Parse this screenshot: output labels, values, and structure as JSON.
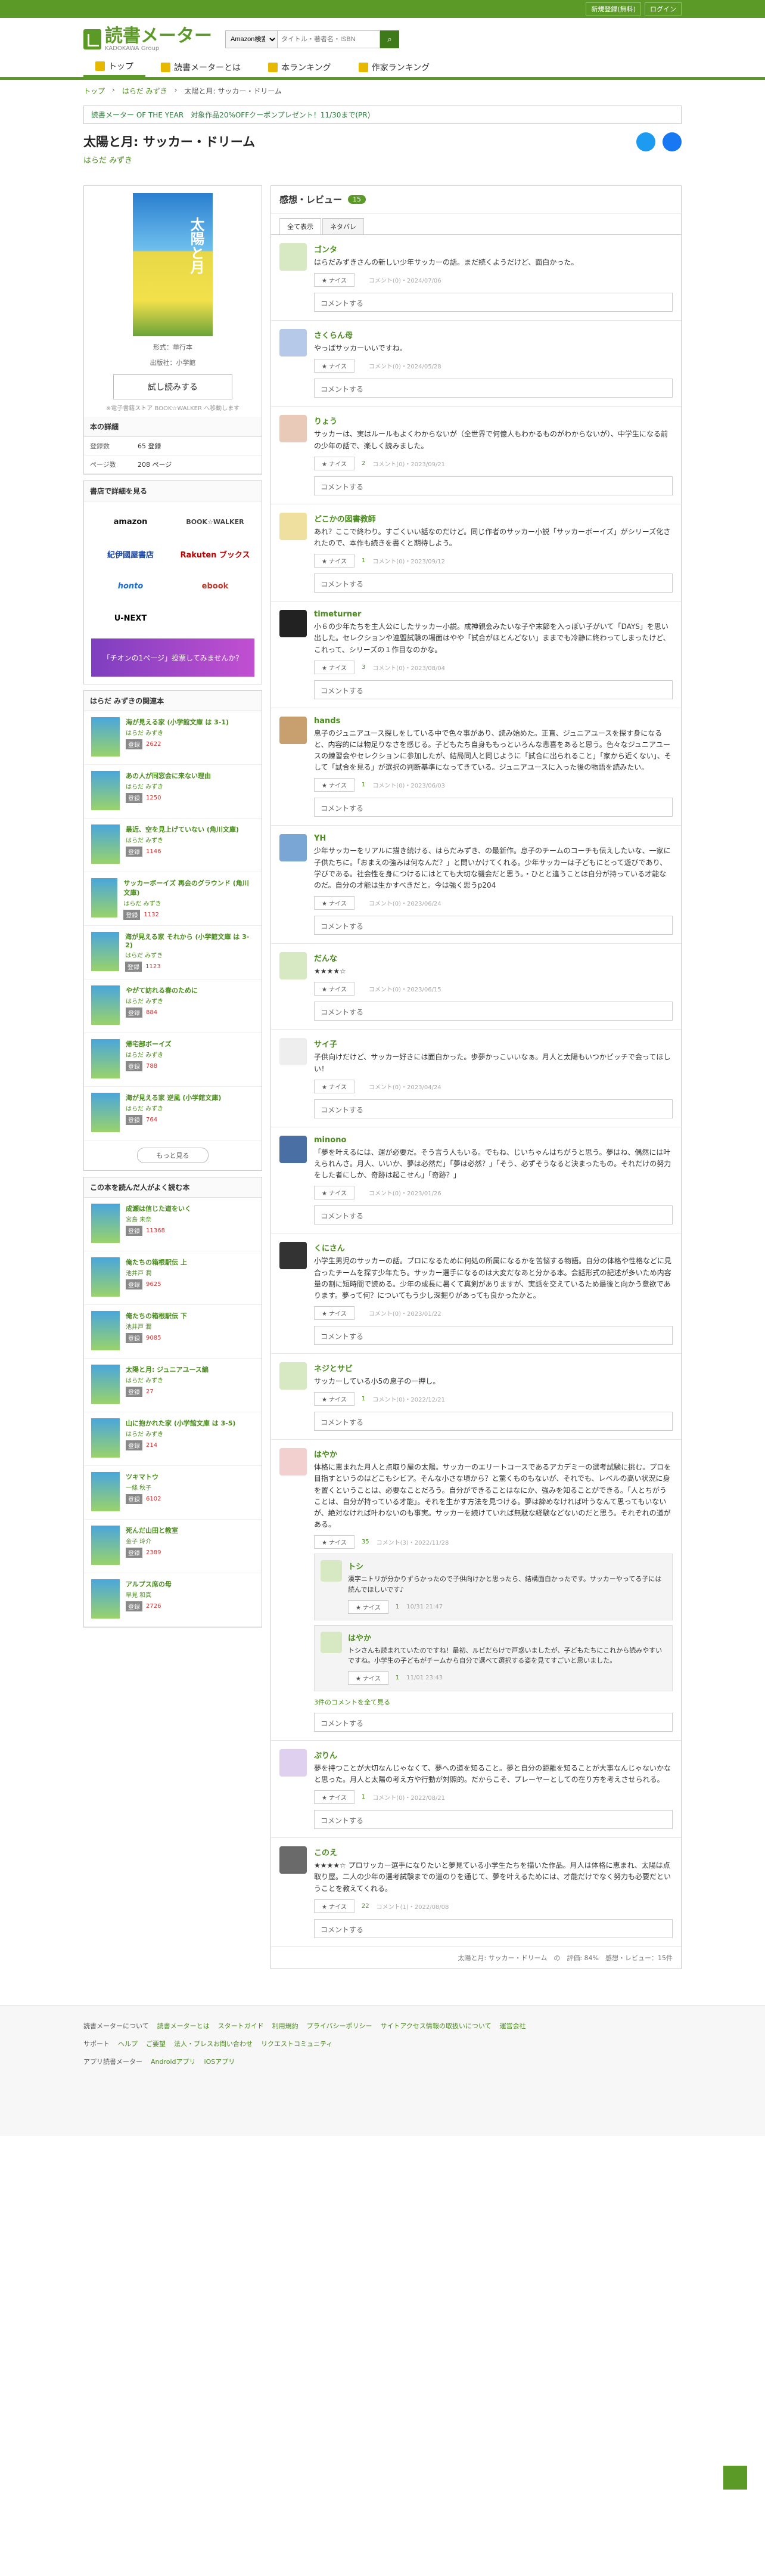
{
  "topbar": {
    "signup": "新規登録(無料)",
    "login": "ログイン"
  },
  "header": {
    "logo_title": "読書メーター",
    "logo_sub": "KADOKAWA Group",
    "search_select": "Amazon検索",
    "search_placeholder": "タイトル・著者名・ISBN"
  },
  "nav": [
    "トップ",
    "読書メーターとは",
    "本ランキング",
    "作家ランキング"
  ],
  "breadcrumb": [
    "トップ",
    "はらだ みずき",
    "太陽と月: サッカー・ドリーム"
  ],
  "banner": "読書メーター OF THE YEAR　対象作品20%OFFクーポンプレゼント！11/30まで(PR)",
  "book": {
    "title": "太陽と月: サッカー・ドリーム",
    "author": "はらだ みずき",
    "format": "形式：単行本",
    "publisher": "出版社：小学館",
    "try": "試し読みする",
    "note": "※電子書籍ストア BOOK☆WALKER へ移動します",
    "cover_text": "太陽と月"
  },
  "details": {
    "heading": "本の詳細",
    "pages_label": "登録数",
    "pages_value": "65 登録",
    "p2_label": "ページ数",
    "p2_value": "208 ページ"
  },
  "stores": {
    "heading": "書店で詳細を見る",
    "items": [
      "amazon",
      "BOOK☆WALKER",
      "紀伊國屋書店",
      "Rakuten ブックス",
      "honto",
      "ebook",
      "U-NEXT"
    ],
    "promo": "「チオンの1ページ」投票してみませんか？"
  },
  "related": {
    "heading": "はらだ みずきの関連本",
    "more": "もっと見る",
    "items": [
      {
        "title": "海が見える家 (小学館文庫 は 3-1)",
        "author": "はらだ みずき",
        "count": "2622"
      },
      {
        "title": "あの人が同窓会に来ない理由",
        "author": "はらだ みずき",
        "count": "1250"
      },
      {
        "title": "最近、空を見上げていない (角川文庫)",
        "author": "はらだ みずき",
        "count": "1146"
      },
      {
        "title": "サッカーボーイズ 再会のグラウンド (角川文庫)",
        "author": "はらだ みずき",
        "count": "1132"
      },
      {
        "title": "海が見える家 それから (小学館文庫 は 3-2)",
        "author": "はらだ みずき",
        "count": "1123"
      },
      {
        "title": "やがて訪れる春のために",
        "author": "はらだ みずき",
        "count": "884"
      },
      {
        "title": "帰宅部ボーイズ",
        "author": "はらだ みずき",
        "count": "788"
      },
      {
        "title": "海が見える家 逆風 (小学館文庫)",
        "author": "はらだ みずき",
        "count": "764"
      }
    ]
  },
  "alsoread": {
    "heading": "この本を読んだ人がよく読む本",
    "items": [
      {
        "title": "成瀬は信じた道をいく",
        "author": "宮島 未奈",
        "count": "11368"
      },
      {
        "title": "俺たちの箱根駅伝 上",
        "author": "池井戸 潤",
        "count": "9625"
      },
      {
        "title": "俺たちの箱根駅伝 下",
        "author": "池井戸 潤",
        "count": "9085"
      },
      {
        "title": "太陽と月: ジュニアユース編",
        "author": "はらだ みずき",
        "count": "27"
      },
      {
        "title": "山に抱かれた家 (小学館文庫 は 3-5)",
        "author": "はらだ みずき",
        "count": "214"
      },
      {
        "title": "ツキマトウ",
        "author": "一條 秋子",
        "count": "6102"
      },
      {
        "title": "死んだ山田と教室",
        "author": "金子 玲介",
        "count": "2389"
      },
      {
        "title": "アルプス席の母",
        "author": "早見 和真",
        "count": "2726"
      }
    ]
  },
  "reviews": {
    "heading": "感想・レビュー",
    "count": "15",
    "tabs": [
      "全て表示",
      "ネタバレ"
    ],
    "nice": "ナイス",
    "comment_box": "コメントする",
    "items": [
      {
        "name": "ゴンタ",
        "text": "はらだみずきさんの新しい少年サッカーの話。まだ続くようだけど、面白かった。",
        "likes": "",
        "date": "コメント(0)・2024/07/06"
      },
      {
        "name": "さくらん母",
        "text": "やっぱサッカーいいですね。",
        "likes": "",
        "date": "コメント(0)・2024/05/28"
      },
      {
        "name": "りょう",
        "text": "サッカーは、実はルールもよくわからないが（全世界で何億人もわかるものがわからないが）、中学生になる前の少年の話で、楽しく読みました。",
        "likes": "2",
        "date": "コメント(0)・2023/09/21"
      },
      {
        "name": "どこかの図書教師",
        "text": "あれ？ここで終わり。すごくいい話なのだけど。同じ作者のサッカー小説「サッカーボーイズ」がシリーズ化されたので、本作も続きを書くと期待しよう。",
        "likes": "1",
        "date": "コメント(0)・2023/09/12"
      },
      {
        "name": "timeturner",
        "text": "小６の少年たちを主人公にしたサッカー小説。成神親会みたいな子や末節を入っぽい子がいて「DAYS」を思い出した。セレクションや連盟試験の場面はやや「試合がほとんどない」ままでも冷静に終わってしまったけど、これって、シリーズの１作目なのかな。",
        "likes": "3",
        "date": "コメント(0)・2023/08/04"
      },
      {
        "name": "hands",
        "text": "息子のジュニアユース探しをしている中で色々事があり、読み始めた。正直、ジュニアユースを探す身になると、内容的には物足りなさを感じる。子どもたち自身ももっといろんな悲喜をあると思う。色々なジュニアユースの練習会やセレクションに参加したが、結局同人と同じように「試合に出られること」「家から近くない」、そして「試合を見る」が選択の判断基準になってきている。ジュニアユースに入った後の物語を読みたい。",
        "likes": "1",
        "date": "コメント(0)・2023/06/03"
      },
      {
        "name": "YH",
        "text": "少年サッカーをリアルに描き続ける、はらだみずき、の最新作。息子のチームのコーチも伝えしたいな、一家に子供たちに。「おまえの強みは何なんだ？」と問いかけてくれる。少年サッカーは子どもにとって遊びであり、学びである。社会性を身につけるにはとても大切な機会だと思う。・ひとと違うことは自分が持っている才能なのだ。自分の才能は生かすべきだと。今は強く思うp204",
        "likes": "",
        "date": "コメント(0)・2023/06/24"
      },
      {
        "name": "だんな",
        "text": "★★★★☆",
        "likes": "",
        "date": "コメント(0)・2023/06/15"
      },
      {
        "name": "サイ子",
        "text": "子供向けだけど、サッカー好きには面白かった。歩夢かっこいいなぁ。月人と太陽もいつかピッチで会ってほしい！",
        "likes": "",
        "date": "コメント(0)・2023/04/24"
      },
      {
        "name": "minono",
        "text": "「夢を叶えるには、運が必要だ。そう言う人もいる。でもね、じいちゃんはちがうと思う。夢はね、偶然には叶えられんさ。月人、いいか、夢は必然だ」「夢は必然？」「そう、必ずそうなると決まったもの。それだけの努力をした者にしか、奇跡は起こせん」「奇跡？」",
        "likes": "",
        "date": "コメント(0)・2023/01/26"
      },
      {
        "name": "くにさん",
        "text": "小学生男児のサッカーの話。プロになるために何処の所属になるかを苦悩する物語。自分の体格や性格などに見合ったチームを探す少年たち。サッカー選手になるのは大変だなあと分かる本。会話形式の記述が多いため内容量の割に短時間で読める。少年の成長に暑くて真剣がありますが、実話を交えているため最後と向かう意欲であります。夢って何？についてもう少し深掘りがあっても良かったかと。",
        "likes": "",
        "date": "コメント(0)・2023/01/22"
      },
      {
        "name": "ネジとサビ",
        "text": "サッカーしている小5の息子の一押し。",
        "likes": "1",
        "date": "コメント(0)・2022/12/21"
      },
      {
        "name": "はやか",
        "text": "体格に恵まれた月人と点取り屋の太陽。サッカーのエリートコースであるアカデミーの選考試験に挑む。プロを目指すというのはどこもシビア。そんな小さな頃から？と驚くものもないが、それでも、レベルの高い状況に身を置くということは、必要なことだろう。自分ができることはなにか、強みを知ることができる。「人とちがうことは、自分が持っている才能」。それを生かす方法を見つける。夢は諦めなければ叶うなんて思ってもいないが、絶対なければ叶わないのも事実。サッカーを続けていれば無駄な経験などないのだと思う。それぞれの道がある。",
        "likes": "35",
        "date": "コメント(3)・2022/11/28"
      },
      {
        "name": "ぷりん",
        "text": "夢を持つことが大切なんじゃなくて、夢への道を知ること。夢と自分の距離を知ることが大事なんじゃないかなと思った。月人と太陽の考え方や行動が対照的。だからこそ、プレーヤーとしての在り方を考えさせられる。",
        "likes": "1",
        "date": "コメント(0)・2022/08/21"
      },
      {
        "name": "このえ",
        "text": "★★★★☆ プロサッカー選手になりたいと夢見ている小学生たちを描いた作品。月人は体格に恵まれ、太陽は点取り屋。二人の少年の選考試験までの道のりを通じて、夢を叶えるためには、才能だけでなく努力も必要だということを教えてくれる。",
        "likes": "22",
        "date": "コメント(1)・2022/08/08"
      }
    ],
    "replies": [
      {
        "name": "トシ",
        "text": "漢字ニトリが分かりずらかったので子供向けかと思ったら、結構面白かったです。サッカーやってる子には読んでほしいです♪",
        "likes": "1",
        "date": "10/31 21:47"
      },
      {
        "name": "はやか",
        "text": "トシさんも読まれていたのですね！最初、ルビだらけで戸惑いましたが、子どもたちにこれから読みやすいですね。小学生の子どもがチームから自分で選べて選択する姿を見てすごいと思いました。",
        "likes": "1",
        "date": "11/01 23:43"
      }
    ],
    "replies_more": "3件のコメントを全て見る",
    "footer_note": "太陽と月: サッカー・ドリーム　の　評価: 84%　感想・レビュー：15件"
  },
  "footer": {
    "row1": [
      "読書メーターについて",
      "読書メーターとは",
      "スタートガイド",
      "利用規約",
      "プライバシーポリシー",
      "サイトアクセス情報の取扱いについて",
      "運営会社"
    ],
    "row2": [
      "サポート",
      "ヘルプ",
      "ご要望",
      "法人・プレスお問い合わせ",
      "リクエストコミュニティ"
    ],
    "row3": [
      "アプリ読書メーター",
      "Androidアプリ",
      "iOSアプリ"
    ]
  },
  "colors": {
    "brand": "#5b9a27",
    "accent": "#4a8c1c"
  }
}
